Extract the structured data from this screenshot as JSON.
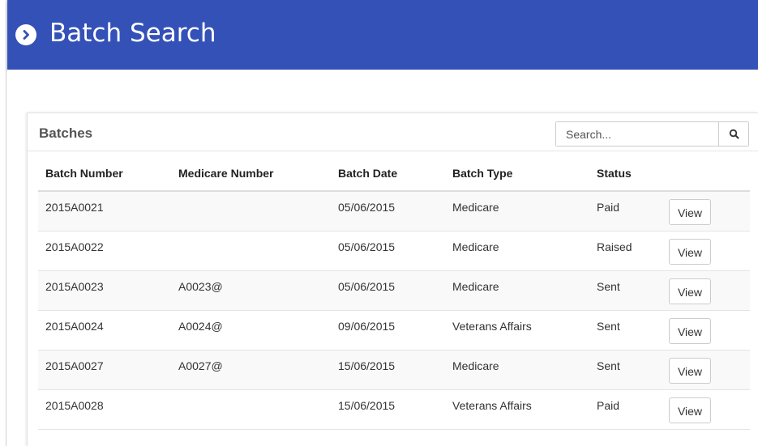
{
  "header": {
    "title": "Batch Search",
    "icon": "chevron-circle-right-icon",
    "color": "#3451b8"
  },
  "panel": {
    "title": "Batches"
  },
  "search": {
    "placeholder": "Search...",
    "value": "",
    "icon": "search-icon"
  },
  "table": {
    "columns": [
      "Batch Number",
      "Medicare Number",
      "Batch Date",
      "Batch Type",
      "Status",
      ""
    ],
    "rows": [
      {
        "batch_number": "2015A0021",
        "medicare_number": "",
        "batch_date": "05/06/2015",
        "batch_type": "Medicare",
        "status": "Paid",
        "action": "View"
      },
      {
        "batch_number": "2015A0022",
        "medicare_number": "",
        "batch_date": "05/06/2015",
        "batch_type": "Medicare",
        "status": "Raised",
        "action": "View"
      },
      {
        "batch_number": "2015A0023",
        "medicare_number": "A0023@",
        "batch_date": "05/06/2015",
        "batch_type": "Medicare",
        "status": "Sent",
        "action": "View"
      },
      {
        "batch_number": "2015A0024",
        "medicare_number": "A0024@",
        "batch_date": "09/06/2015",
        "batch_type": "Veterans Affairs",
        "status": "Sent",
        "action": "View"
      },
      {
        "batch_number": "2015A0027",
        "medicare_number": "A0027@",
        "batch_date": "15/06/2015",
        "batch_type": "Medicare",
        "status": "Sent",
        "action": "View"
      },
      {
        "batch_number": "2015A0028",
        "medicare_number": "",
        "batch_date": "15/06/2015",
        "batch_type": "Veterans Affairs",
        "status": "Paid",
        "action": "View"
      }
    ]
  }
}
